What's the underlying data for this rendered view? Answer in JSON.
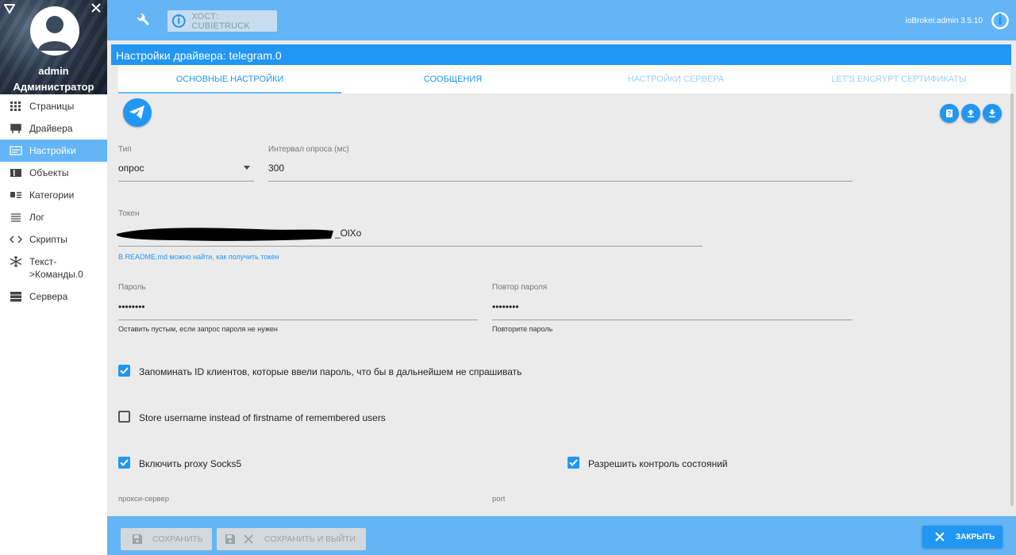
{
  "sidebar": {
    "user": {
      "name": "admin",
      "role": "Администратор"
    },
    "items": [
      {
        "label": "Страницы",
        "icon": "grid-icon"
      },
      {
        "label": "Драйвера",
        "icon": "drivers-icon"
      },
      {
        "label": "Настройки",
        "icon": "settings-list-icon",
        "active": true
      },
      {
        "label": "Объекты",
        "icon": "objects-icon"
      },
      {
        "label": "Категории",
        "icon": "categories-icon"
      },
      {
        "label": "Лог",
        "icon": "log-icon"
      },
      {
        "label": "Скрипты",
        "icon": "code-icon"
      },
      {
        "label": "Текст->Команды.0",
        "icon": "snowflake-icon"
      },
      {
        "label": "Сервера",
        "icon": "servers-icon"
      }
    ]
  },
  "topbar": {
    "host_label": "ХОСТ: CUBIETRUCK",
    "app_version": "ioBroker.admin 3.5.10"
  },
  "page": {
    "title": "Настройки драйвера: telegram.0",
    "tabs": [
      {
        "label": "ОСНОВНЫЕ НАСТРОЙКИ",
        "active": true
      },
      {
        "label": "СООБЩЕНИЯ"
      },
      {
        "label": "НАСТРОЙКИ СЕРВЕРА",
        "disabled": true
      },
      {
        "label": "LET'S ENCRYPT СЕРТИФИКАТЫ",
        "disabled": true
      }
    ]
  },
  "form": {
    "type": {
      "label": "Тип",
      "value": "опрос"
    },
    "poll_interval": {
      "label": "Интервал опроса (мс)",
      "value": "300"
    },
    "token": {
      "label": "Токен",
      "value_visible_tail": "_OlXo",
      "help": "В README.md можно найти, как получить токен"
    },
    "password": {
      "label": "Пароль",
      "value": "••••••••",
      "help": "Оставить пустым, если запрос пароля не нужен"
    },
    "password_repeat": {
      "label": "Повтор пароля",
      "value": "••••••••",
      "help": "Повторите пароль"
    },
    "remember_ids": {
      "label": "Запоминать ID клиентов, которые ввели пароль, что бы в дальнейшем не спрашивать",
      "checked": true
    },
    "store_username": {
      "label": "Store username instead of firstname of remembered users",
      "checked": false
    },
    "proxy_socks5": {
      "label": "Включить proxy Socks5",
      "checked": true
    },
    "allow_states": {
      "label": "Разрешить контроль состояний",
      "checked": true
    },
    "proxy_server": {
      "label": "прокси-сервер"
    },
    "port": {
      "label": "port"
    }
  },
  "bottombar": {
    "save_label": "СОХРАНИТЬ",
    "save_close_label": "СОХРАНИТЬ И ВЫЙТИ",
    "close_label": "ЗАКРЫТЬ"
  },
  "colors": {
    "primary": "#2196f3",
    "bar": "#64b5f6",
    "background": "#ebebeb"
  }
}
